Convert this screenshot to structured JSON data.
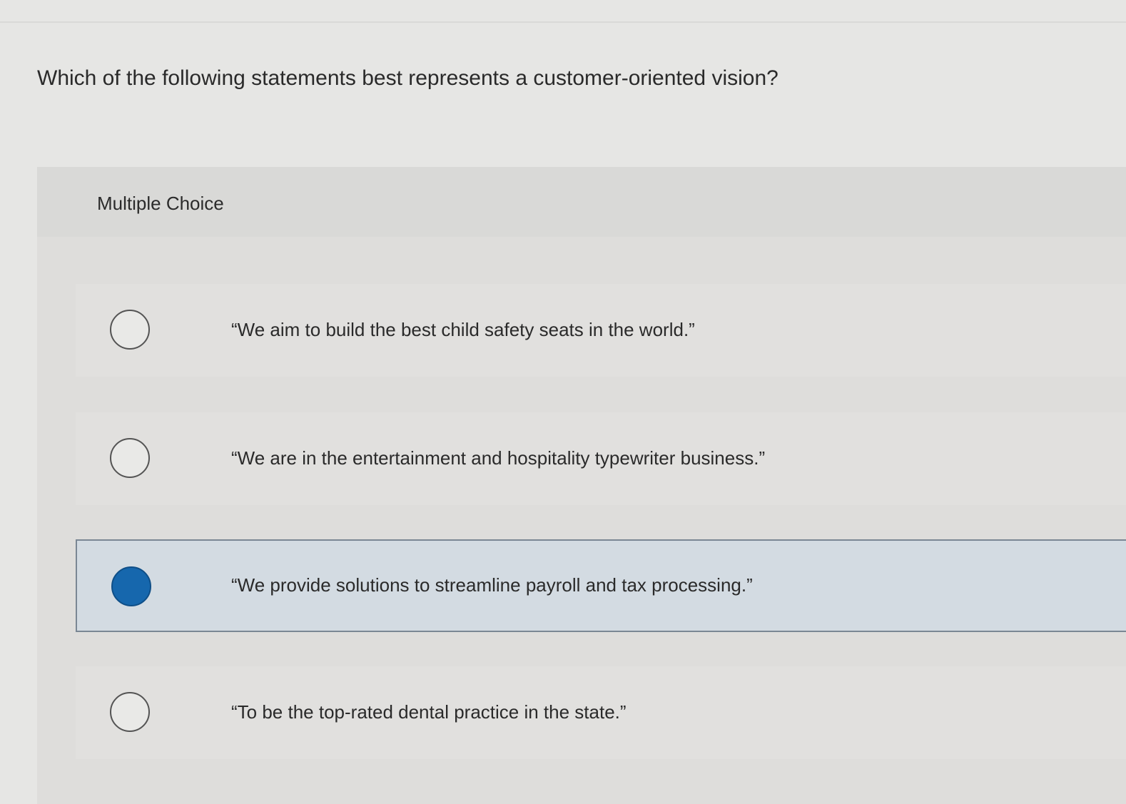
{
  "question": {
    "text": "Which of the following statements best represents a customer-oriented vision?"
  },
  "multiple_choice": {
    "label": "Multiple Choice",
    "options": [
      {
        "text": "“We aim to build the best child safety seats in the world.”",
        "selected": false
      },
      {
        "text": "“We are in the entertainment and hospitality typewriter business.”",
        "selected": false
      },
      {
        "text": "“We provide solutions to streamline payroll and tax processing.”",
        "selected": true
      },
      {
        "text": "“To be the top-rated dental practice in the state.”",
        "selected": false
      }
    ]
  },
  "colors": {
    "selected_radio": "#1667ad",
    "selected_background": "#d3dbe2",
    "page_background": "#e6e6e4"
  }
}
